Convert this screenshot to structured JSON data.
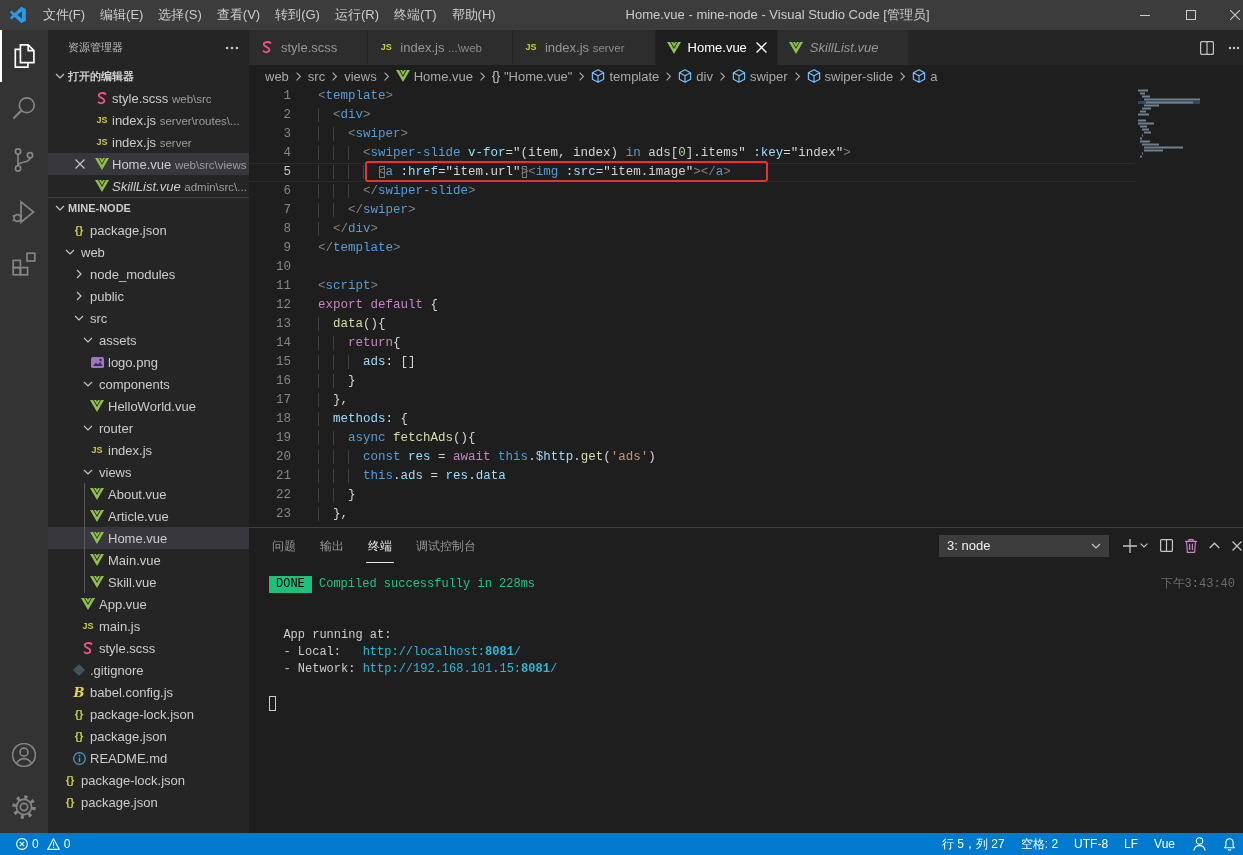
{
  "window": {
    "title": "Home.vue - mine-node - Visual Studio Code [管理员]",
    "menus": [
      "文件(F)",
      "编辑(E)",
      "选择(S)",
      "查看(V)",
      "转到(G)",
      "运行(R)",
      "终端(T)",
      "帮助(H)"
    ]
  },
  "activity_bar": [
    {
      "kind": "explorer",
      "selected": true
    },
    {
      "kind": "search",
      "selected": false
    },
    {
      "kind": "source-control",
      "selected": false
    },
    {
      "kind": "run",
      "selected": false
    },
    {
      "kind": "extensions",
      "selected": false
    }
  ],
  "sidebar": {
    "title": "资源管理器"
  },
  "open_editors": {
    "title": "打开的编辑器",
    "expanded": true,
    "items": [
      {
        "name": "style.scss",
        "description": "web\\src",
        "kind": "scss",
        "selected": false,
        "preview": false
      },
      {
        "name": "index.js",
        "description": "server\\routes\\...",
        "kind": "js",
        "icon_text": "JS",
        "selected": false,
        "preview": false
      },
      {
        "name": "index.js",
        "description": "server",
        "kind": "js",
        "icon_text": "JS",
        "selected": false,
        "preview": false
      },
      {
        "name": "Home.vue",
        "description": "web\\src\\views",
        "kind": "vue",
        "selected": true,
        "preview": false
      },
      {
        "name": "SkillList.vue",
        "description": "admin\\src\\...",
        "kind": "vue",
        "selected": false,
        "preview": true
      }
    ]
  },
  "workspace": {
    "title": "MINE-NODE",
    "expanded": true,
    "tree": [
      {
        "children": [
          {
            "name": "package.json",
            "kind": "json",
            "icon_text": "{}",
            "selected": false
          }
        ]
      },
      {
        "name": "web",
        "kind": "folder",
        "expanded": true,
        "selected": false,
        "children": [
          {
            "name": "node_modules",
            "kind": "folder",
            "expanded": false,
            "selected": false
          },
          {
            "name": "public",
            "kind": "folder",
            "expanded": false,
            "selected": false
          },
          {
            "name": "src",
            "kind": "folder",
            "expanded": true,
            "selected": false,
            "children": [
              {
                "name": "assets",
                "kind": "folder",
                "expanded": true,
                "selected": false,
                "children": [
                  {
                    "name": "logo.png",
                    "kind": "image",
                    "selected": false
                  }
                ]
              },
              {
                "name": "components",
                "kind": "folder",
                "expanded": true,
                "selected": false,
                "children": [
                  {
                    "name": "HelloWorld.vue",
                    "kind": "vue",
                    "selected": false
                  }
                ]
              },
              {
                "name": "router",
                "kind": "folder",
                "expanded": true,
                "selected": false,
                "children": [
                  {
                    "name": "index.js",
                    "kind": "js",
                    "icon_text": "JS",
                    "selected": false
                  }
                ]
              },
              {
                "name": "views",
                "kind": "folder",
                "expanded": true,
                "selected": false,
                "children": [
                  {
                    "name": "About.vue",
                    "kind": "vue",
                    "selected": false
                  },
                  {
                    "name": "Article.vue",
                    "kind": "vue",
                    "selected": false
                  },
                  {
                    "name": "Home.vue",
                    "kind": "vue",
                    "selected": true
                  },
                  {
                    "name": "Main.vue",
                    "kind": "vue",
                    "selected": false
                  },
                  {
                    "name": "Skill.vue",
                    "kind": "vue",
                    "selected": false
                  }
                ]
              },
              {
                "name": "App.vue",
                "kind": "vue",
                "selected": false
              },
              {
                "name": "main.js",
                "kind": "js",
                "icon_text": "JS",
                "selected": false
              },
              {
                "name": "style.scss",
                "kind": "scss",
                "selected": false
              }
            ]
          },
          {
            "name": ".gitignore",
            "kind": "git",
            "selected": false
          },
          {
            "name": "babel.config.js",
            "kind": "babel",
            "icon_text": "B",
            "selected": false
          },
          {
            "name": "package-lock.json",
            "kind": "json",
            "icon_text": "{}",
            "selected": false
          },
          {
            "name": "package.json",
            "kind": "json",
            "icon_text": "{}",
            "selected": false
          },
          {
            "name": "README.md",
            "kind": "info",
            "selected": false
          }
        ]
      },
      {
        "name": "package-lock.json",
        "kind": "json",
        "icon_text": "{}",
        "selected": false
      },
      {
        "name": "package.json",
        "kind": "json",
        "icon_text": "{}",
        "selected": false
      }
    ]
  },
  "editor_tabs": [
    {
      "name": "style.scss",
      "kind": "scss",
      "selected": false,
      "preview": false
    },
    {
      "name": "index.js",
      "description": "...\\web",
      "kind": "js",
      "icon_text": "JS",
      "selected": false,
      "preview": false
    },
    {
      "name": "index.js",
      "description": "server",
      "kind": "js",
      "icon_text": "JS",
      "selected": false,
      "preview": false
    },
    {
      "name": "Home.vue",
      "kind": "vue",
      "selected": true,
      "preview": false
    },
    {
      "name": "SkillList.vue",
      "kind": "vue",
      "selected": false,
      "preview": true
    }
  ],
  "breadcrumbs": [
    {
      "label": "web",
      "kind": "folder"
    },
    {
      "label": "src",
      "kind": "folder"
    },
    {
      "label": "views",
      "kind": "folder"
    },
    {
      "label": "Home.vue",
      "kind": "vue"
    },
    {
      "label": "\"Home.vue\"",
      "kind": "module",
      "icon_text": "{}"
    },
    {
      "label": "template",
      "kind": "element"
    },
    {
      "label": "div",
      "kind": "element"
    },
    {
      "label": "swiper",
      "kind": "element"
    },
    {
      "label": "swiper-slide",
      "kind": "element"
    },
    {
      "label": "a",
      "kind": "element"
    }
  ],
  "code_lines": [
    {
      "number": "1",
      "current": false,
      "annotated": false,
      "tokens": [
        {
          "text": "<",
          "kind": "punct"
        },
        {
          "text": "template",
          "kind": "tag"
        },
        {
          "text": ">",
          "kind": "punct"
        }
      ]
    },
    {
      "number": "2",
      "current": false,
      "annotated": false,
      "tokens": [
        {
          "text": "  <",
          "kind": "punct"
        },
        {
          "text": "div",
          "kind": "tag"
        },
        {
          "text": ">",
          "kind": "punct"
        }
      ]
    },
    {
      "number": "3",
      "current": false,
      "annotated": false,
      "tokens": [
        {
          "text": "    <",
          "kind": "punct"
        },
        {
          "text": "swiper",
          "kind": "tag"
        },
        {
          "text": ">",
          "kind": "punct"
        }
      ]
    },
    {
      "number": "4",
      "current": false,
      "annotated": false,
      "tokens": [
        {
          "text": "      <",
          "kind": "punct"
        },
        {
          "text": "swiper-slide",
          "kind": "tag"
        },
        {
          "text": " v-for",
          "kind": "attr"
        },
        {
          "text": "=\"(item, index) ",
          "kind": "plain"
        },
        {
          "text": "in",
          "kind": "storage"
        },
        {
          "text": " ads[",
          "kind": "plain"
        },
        {
          "text": "0",
          "kind": "number"
        },
        {
          "text": "].items\"",
          "kind": "plain"
        },
        {
          "text": " :key",
          "kind": "attr"
        },
        {
          "text": "=\"index\"",
          "kind": "plain"
        },
        {
          "text": ">",
          "kind": "punct"
        }
      ]
    },
    {
      "number": "5",
      "current": true,
      "annotated": true,
      "tokens": [
        {
          "text": "        <",
          "kind": "matched-bracket"
        },
        {
          "text": "a",
          "kind": "tag"
        },
        {
          "text": " :href",
          "kind": "attr"
        },
        {
          "text": "=\"item.url\"",
          "kind": "plain"
        },
        {
          "text": ">",
          "kind": "matched-bracket"
        },
        {
          "text": "<",
          "kind": "punct"
        },
        {
          "text": "img",
          "kind": "tag"
        },
        {
          "text": " :src",
          "kind": "attr"
        },
        {
          "text": "=\"item.image\"",
          "kind": "plain"
        },
        {
          "text": "></",
          "kind": "punct"
        },
        {
          "text": "a",
          "kind": "tag"
        },
        {
          "text": ">",
          "kind": "punct"
        }
      ]
    },
    {
      "number": "6",
      "current": false,
      "annotated": false,
      "tokens": [
        {
          "text": "      </",
          "kind": "punct"
        },
        {
          "text": "swiper-slide",
          "kind": "tag"
        },
        {
          "text": ">",
          "kind": "punct"
        }
      ]
    },
    {
      "number": "7",
      "current": false,
      "annotated": false,
      "tokens": [
        {
          "text": "    </",
          "kind": "punct"
        },
        {
          "text": "swiper",
          "kind": "tag"
        },
        {
          "text": ">",
          "kind": "punct"
        }
      ]
    },
    {
      "number": "8",
      "current": false,
      "annotated": false,
      "tokens": [
        {
          "text": "  </",
          "kind": "punct"
        },
        {
          "text": "div",
          "kind": "tag"
        },
        {
          "text": ">",
          "kind": "punct"
        }
      ]
    },
    {
      "number": "9",
      "current": false,
      "annotated": false,
      "tokens": [
        {
          "text": "</",
          "kind": "punct"
        },
        {
          "text": "template",
          "kind": "tag"
        },
        {
          "text": ">",
          "kind": "punct"
        }
      ]
    },
    {
      "number": "10",
      "current": false,
      "annotated": false
    },
    {
      "number": "11",
      "current": false,
      "annotated": false,
      "tokens": [
        {
          "text": "<",
          "kind": "punct"
        },
        {
          "text": "script",
          "kind": "tag"
        },
        {
          "text": ">",
          "kind": "punct"
        }
      ]
    },
    {
      "number": "12",
      "current": false,
      "annotated": false,
      "tokens": [
        {
          "text": "export",
          "kind": "keyword"
        },
        {
          "text": " default",
          "kind": "keyword"
        },
        {
          "text": " {",
          "kind": "plain"
        }
      ]
    },
    {
      "number": "13",
      "current": false,
      "annotated": false,
      "tokens": [
        {
          "text": "  data",
          "kind": "func"
        },
        {
          "text": "(){",
          "kind": "plain"
        }
      ]
    },
    {
      "number": "14",
      "current": false,
      "annotated": false,
      "tokens": [
        {
          "text": "    return",
          "kind": "keyword"
        },
        {
          "text": "{",
          "kind": "plain"
        }
      ]
    },
    {
      "number": "15",
      "current": false,
      "annotated": false,
      "tokens": [
        {
          "text": "      ads",
          "kind": "var"
        },
        {
          "text": ": []",
          "kind": "plain"
        }
      ]
    },
    {
      "number": "16",
      "current": false,
      "annotated": false,
      "tokens": [
        {
          "text": "    }",
          "kind": "plain"
        }
      ]
    },
    {
      "number": "17",
      "current": false,
      "annotated": false,
      "tokens": [
        {
          "text": "  },",
          "kind": "plain"
        }
      ]
    },
    {
      "number": "18",
      "current": false,
      "annotated": false,
      "tokens": [
        {
          "text": "  methods",
          "kind": "var"
        },
        {
          "text": ": {",
          "kind": "plain"
        }
      ]
    },
    {
      "number": "19",
      "current": false,
      "annotated": false,
      "tokens": [
        {
          "text": "    async",
          "kind": "storage"
        },
        {
          "text": " fetchAds",
          "kind": "func"
        },
        {
          "text": "(){",
          "kind": "plain"
        }
      ]
    },
    {
      "number": "20",
      "current": false,
      "annotated": false,
      "tokens": [
        {
          "text": "      const",
          "kind": "storage"
        },
        {
          "text": " res",
          "kind": "var"
        },
        {
          "text": " = ",
          "kind": "plain"
        },
        {
          "text": "await",
          "kind": "keyword"
        },
        {
          "text": " this",
          "kind": "storage"
        },
        {
          "text": ".",
          "kind": "plain"
        },
        {
          "text": "$http",
          "kind": "var"
        },
        {
          "text": ".",
          "kind": "plain"
        },
        {
          "text": "get",
          "kind": "func"
        },
        {
          "text": "(",
          "kind": "plain"
        },
        {
          "text": "'ads'",
          "kind": "string"
        },
        {
          "text": ")",
          "kind": "plain"
        }
      ]
    },
    {
      "number": "21",
      "current": false,
      "annotated": false,
      "tokens": [
        {
          "text": "      this",
          "kind": "storage"
        },
        {
          "text": ".",
          "kind": "plain"
        },
        {
          "text": "ads",
          "kind": "var"
        },
        {
          "text": " = ",
          "kind": "plain"
        },
        {
          "text": "res",
          "kind": "var"
        },
        {
          "text": ".",
          "kind": "plain"
        },
        {
          "text": "data",
          "kind": "var"
        }
      ]
    },
    {
      "number": "22",
      "current": false,
      "annotated": false,
      "tokens": [
        {
          "text": "    }",
          "kind": "plain"
        }
      ]
    },
    {
      "number": "23",
      "current": false,
      "annotated": false,
      "tokens": [
        {
          "text": "  },",
          "kind": "plain"
        }
      ]
    }
  ],
  "panel": {
    "tabs": [
      {
        "label": "问题",
        "selected": false
      },
      {
        "label": "输出",
        "selected": false
      },
      {
        "label": "终端",
        "selected": true
      },
      {
        "label": "调试控制台",
        "selected": false
      }
    ],
    "terminal_select": {
      "value": "3: node"
    },
    "lines": [
      {
        "kind": "text",
        "segments": [
          {
            "text": "DONE",
            "kind": "badge"
          },
          {
            "text": " Compiled successfully in 228ms",
            "kind": "success"
          }
        ],
        "timestamp": "下午3:43:40"
      },
      {
        "kind": "blank"
      },
      {
        "kind": "blank"
      },
      {
        "kind": "text",
        "segments": [
          {
            "text": "  App running at:",
            "kind": "plain"
          }
        ]
      },
      {
        "kind": "text",
        "segments": [
          {
            "text": "  - Local:   ",
            "kind": "plain"
          },
          {
            "text": "http://localhost:**8081**/",
            "kind": "link"
          }
        ]
      },
      {
        "kind": "text",
        "segments": [
          {
            "text": "  - Network: ",
            "kind": "plain"
          },
          {
            "text": "http://192.168.101.15:**8081**/",
            "kind": "link"
          }
        ]
      },
      {
        "kind": "blank"
      },
      {
        "kind": "cursor"
      }
    ]
  },
  "status_bar": {
    "errors": "0",
    "warnings": "0",
    "items": [
      "行 5，列 27",
      "空格: 2",
      "UTF-8",
      "LF",
      "Vue"
    ]
  }
}
